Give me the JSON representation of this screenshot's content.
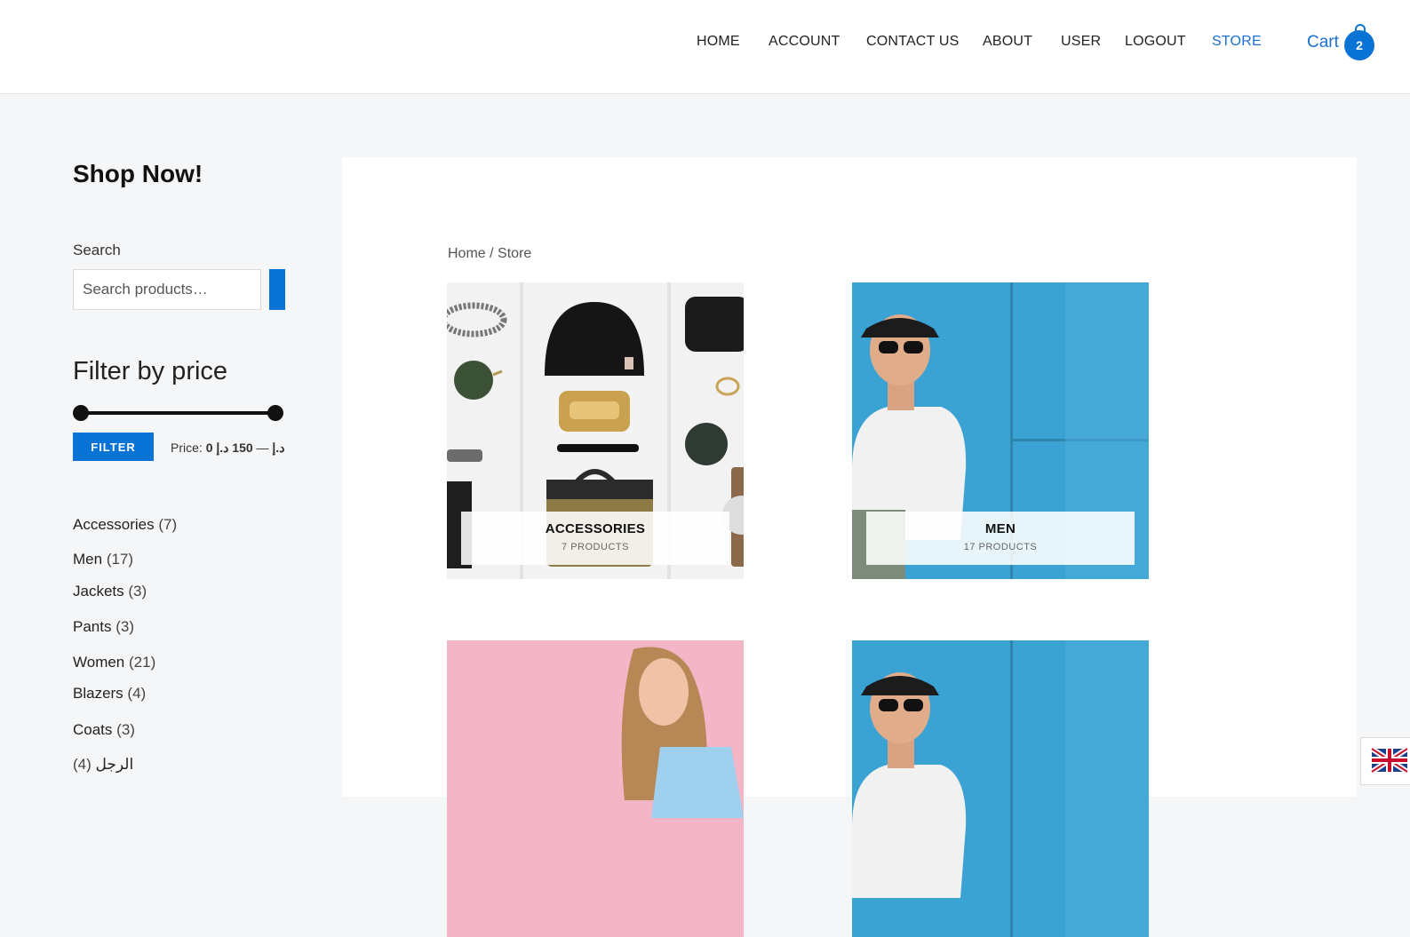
{
  "nav": {
    "items": [
      {
        "label": "HOME"
      },
      {
        "label": "ACCOUNT"
      },
      {
        "label": "CONTACT US"
      },
      {
        "label": "ABOUT"
      },
      {
        "label": "USER"
      },
      {
        "label": "LOGOUT"
      },
      {
        "label": "STORE",
        "active": true
      }
    ],
    "cart_label": "Cart",
    "cart_count": "2"
  },
  "sidebar": {
    "title": "Shop Now!",
    "search_label": "Search",
    "search_placeholder": "Search products…",
    "filter_title": "Filter by price",
    "filter_button": "FILTER",
    "price_prefix": "Price:",
    "price_min": "0 د.إ",
    "price_sep": "—",
    "price_max": "150 د.إ",
    "categories": [
      {
        "name": "Accessories",
        "count": "(7)"
      },
      {
        "name": "Men",
        "count": "(17)"
      },
      {
        "name": "Jackets",
        "count": "(3)"
      },
      {
        "name": "Pants",
        "count": "(3)"
      },
      {
        "name": "Women",
        "count": "(21)"
      },
      {
        "name": "Blazers",
        "count": "(4)"
      },
      {
        "name": "Coats",
        "count": "(3)"
      },
      {
        "name": "الرجل",
        "count": "(4)"
      }
    ]
  },
  "main": {
    "breadcrumb": {
      "home": "Home",
      "sep": "/",
      "current": "Store"
    },
    "tiles": [
      {
        "name": "ACCESSORIES",
        "count": "7 PRODUCTS"
      },
      {
        "name": "MEN",
        "count": "17 PRODUCTS"
      }
    ]
  },
  "colors": {
    "accent": "#0a73d6",
    "link_active": "#1a6fd1",
    "page_bg": "#f5f6f7"
  }
}
